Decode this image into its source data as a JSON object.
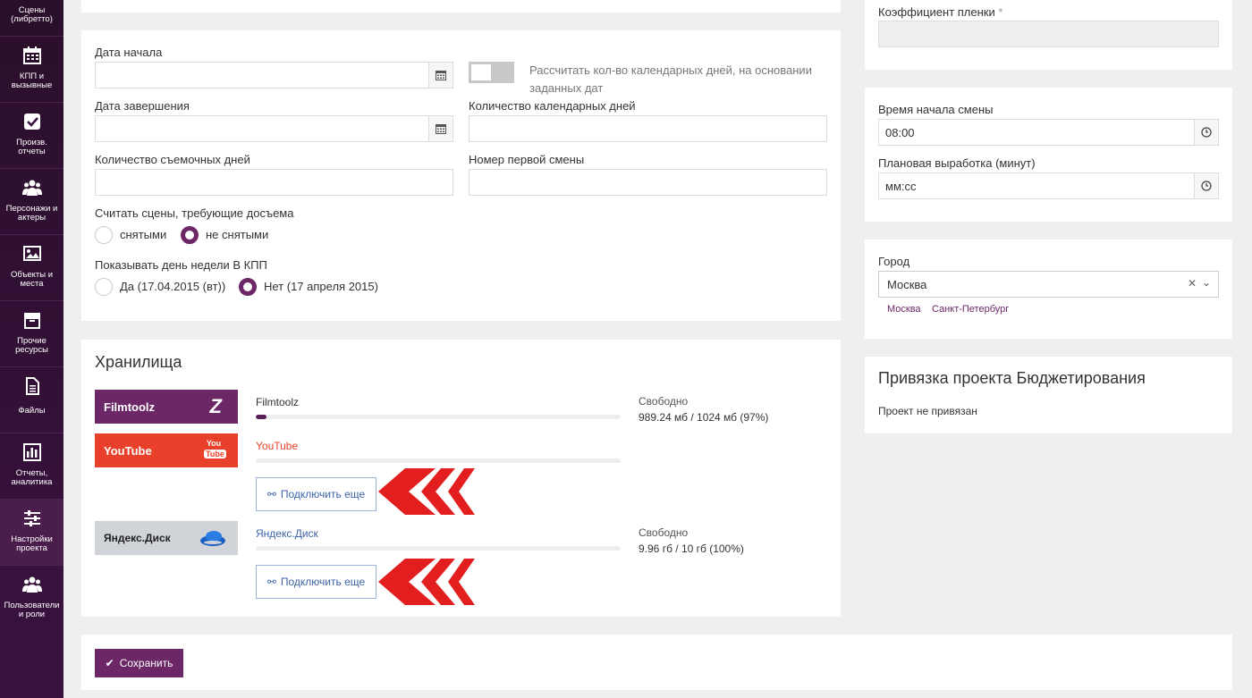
{
  "sidebar": {
    "items": [
      {
        "label": "Сцены (либретто)",
        "icon": "film-icon"
      },
      {
        "label": "КПП и вызывные",
        "icon": "calendar-icon"
      },
      {
        "label": "Произв. отчеты",
        "icon": "check-square-icon"
      },
      {
        "label": "Персонажи и актеры",
        "icon": "users-icon"
      },
      {
        "label": "Объекты и места",
        "icon": "image-icon"
      },
      {
        "label": "Прочие ресурсы",
        "icon": "archive-icon"
      },
      {
        "label": "Файлы",
        "icon": "file-icon"
      },
      {
        "label": "Отчеты, аналитика",
        "icon": "bar-chart-icon"
      },
      {
        "label": "Настройки проекта",
        "icon": "sliders-icon"
      },
      {
        "label": "Пользователи и роли",
        "icon": "users-icon"
      }
    ]
  },
  "dates": {
    "start_label": "Дата начала",
    "end_label": "Дата завершения",
    "toggle_label": "Рассчитать кол-во календарных дней, на основании заданных дат",
    "calendar_days_label": "Количество календарных дней",
    "shooting_days_label": "Количество съемочных дней",
    "first_shift_label": "Номер первой смены",
    "reshoot_label": "Считать сцены, требующие досъема",
    "reshoot_options": [
      "снятыми",
      "не снятыми"
    ],
    "weekday_label": "Показывать день недели В КПП",
    "weekday_options": [
      "Да (17.04.2015 (вт))",
      "Нет (17 апреля 2015)"
    ]
  },
  "storage": {
    "title": "Хранилища",
    "free_label": "Свободно",
    "connect_label": "Подключить еще",
    "items": [
      {
        "logo": "Filmtoolz",
        "name": "Filmtoolz",
        "usage": "989.24 мб / 1024 мб (97%)",
        "fill": 0.03,
        "color": "#6b2766"
      },
      {
        "logo": "YouTube",
        "name": "YouTube",
        "color": "#e8402a"
      },
      {
        "logo": "Яндекс.Диск",
        "name": "Яндекс.Диск",
        "usage": "9.96 гб / 10 гб (100%)",
        "color": "#d0d3d8"
      }
    ]
  },
  "right": {
    "film_coef_label": "Коэффициент пленки",
    "required_mark": "*",
    "shift_start_label": "Время начала смены",
    "shift_start_value": "08:00",
    "output_label": "Плановая выработка (минут)",
    "output_value": "мм:сс",
    "city_label": "Город",
    "city_value": "Москва",
    "city_suggestions": [
      "Москва",
      "Санкт-Петербург"
    ],
    "budget_title": "Привязка проекта Бюджетирования",
    "budget_status": "Проект не привязан"
  },
  "footer": {
    "save_label": "Сохранить"
  }
}
